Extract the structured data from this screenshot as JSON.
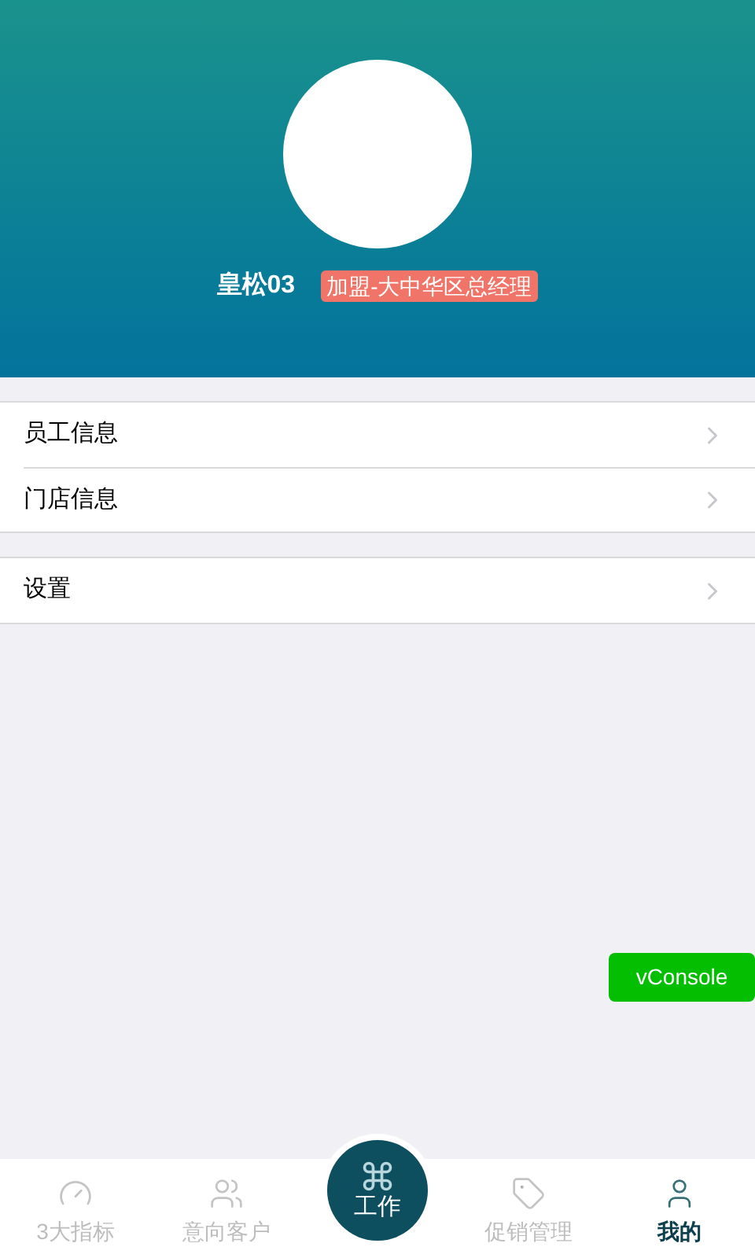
{
  "profile": {
    "name": "皇松03",
    "role": "加盟-大中华区总经理"
  },
  "menu_groups": [
    [
      {
        "label": "员工信息"
      },
      {
        "label": "门店信息"
      }
    ],
    [
      {
        "label": "设置"
      }
    ]
  ],
  "vconsole": "vConsole",
  "tab_bar": [
    {
      "kind": "gauge",
      "label": "3大指标",
      "selected": false
    },
    {
      "kind": "users",
      "label": "意向客户",
      "selected": false
    },
    {
      "kind": "center",
      "label": "工作",
      "selected": false
    },
    {
      "kind": "tag",
      "label": "促销管理",
      "selected": false
    },
    {
      "kind": "user",
      "label": "我的",
      "selected": true
    }
  ]
}
